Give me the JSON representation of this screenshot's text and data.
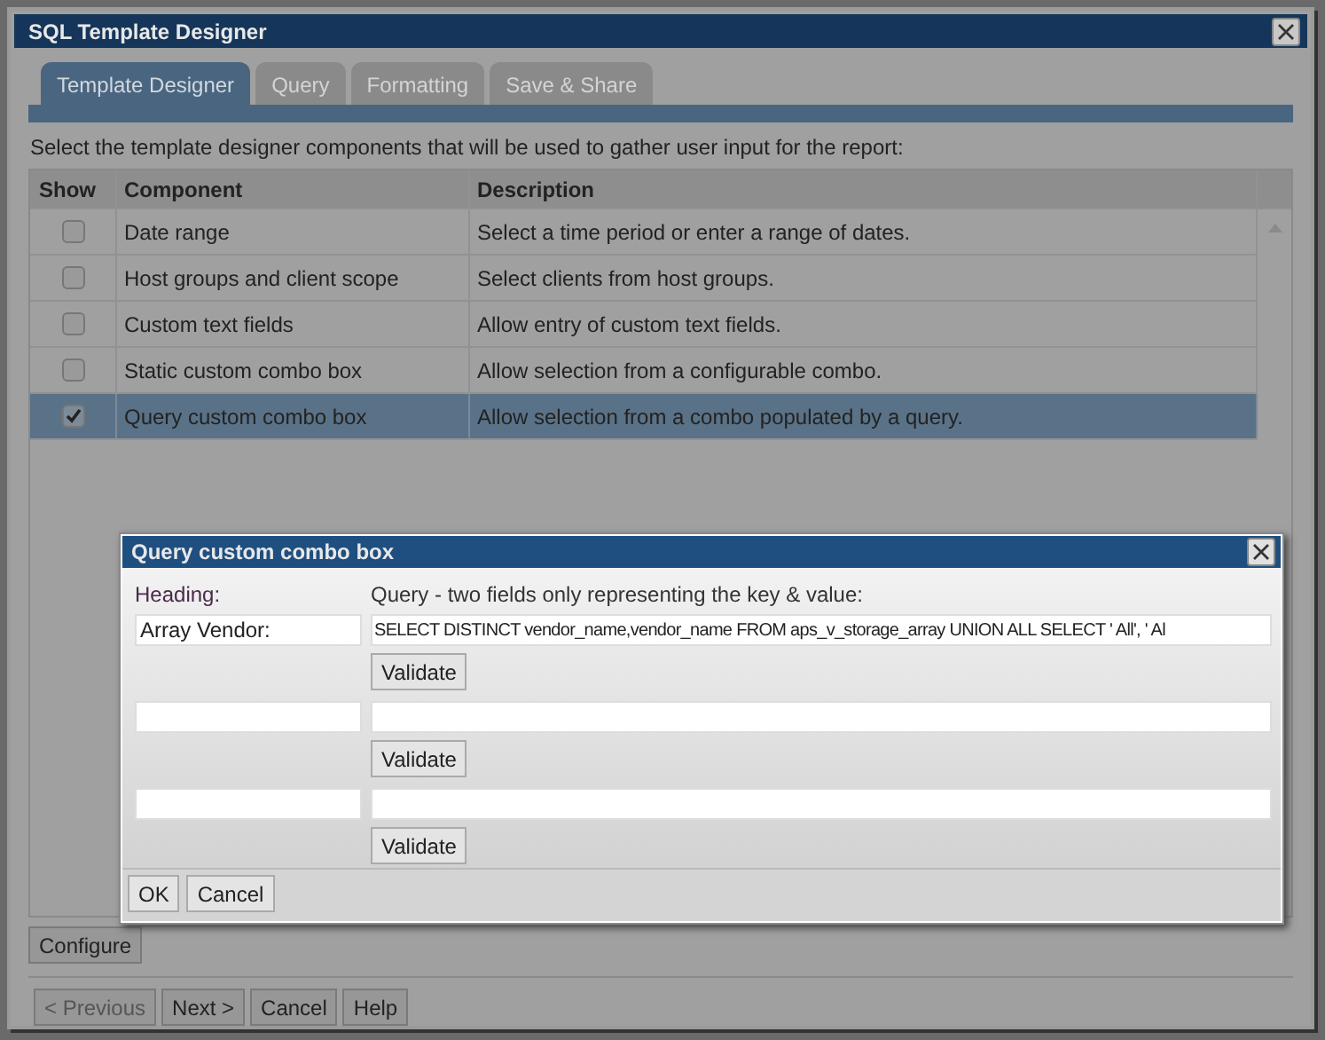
{
  "window": {
    "title": "SQL Template Designer"
  },
  "tabs": [
    {
      "label": "Template Designer",
      "selected": true
    },
    {
      "label": "Query",
      "selected": false
    },
    {
      "label": "Formatting",
      "selected": false
    },
    {
      "label": "Save & Share",
      "selected": false
    }
  ],
  "instruction": "Select the template designer components that will be used to gather user input for the report:",
  "table": {
    "columns": [
      "Show",
      "Component",
      "Description"
    ],
    "rows": [
      {
        "checked": false,
        "selected": false,
        "component": "Date range",
        "description": "Select a time period or enter a range of dates."
      },
      {
        "checked": false,
        "selected": false,
        "component": "Host groups and client scope",
        "description": "Select clients from host groups."
      },
      {
        "checked": false,
        "selected": false,
        "component": "Custom text fields",
        "description": "Allow entry of custom text fields."
      },
      {
        "checked": false,
        "selected": false,
        "component": "Static custom combo box",
        "description": "Allow selection from a configurable combo."
      },
      {
        "checked": true,
        "selected": true,
        "component": "Query custom combo box",
        "description": "Allow selection from a combo populated by a query."
      }
    ]
  },
  "configure_button": "Configure",
  "footer_buttons": [
    {
      "label": "< Previous",
      "disabled": true
    },
    {
      "label": "Next >",
      "disabled": false
    },
    {
      "label": "Cancel",
      "disabled": false
    },
    {
      "label": "Help",
      "disabled": false
    }
  ],
  "dialog": {
    "title": "Query custom combo box",
    "heading_label": "Heading:",
    "query_label": "Query - two fields only representing the key & value:",
    "entries": [
      {
        "heading": "Array Vendor:",
        "query": "SELECT DISTINCT vendor_name,vendor_name FROM aps_v_storage_array UNION ALL SELECT ' All', ' Al",
        "button": "Validate"
      },
      {
        "button": "Validate"
      },
      {
        "button": "Validate"
      }
    ],
    "buttons": [
      "OK",
      "Cancel"
    ]
  }
}
